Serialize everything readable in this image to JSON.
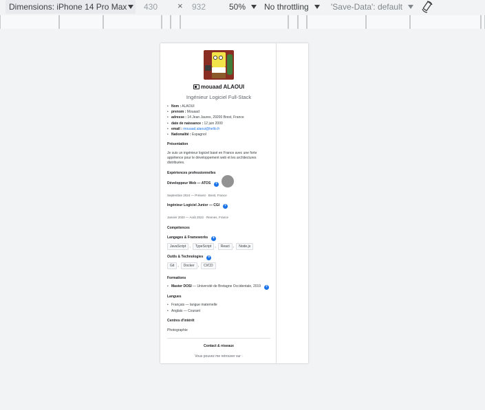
{
  "toolbar": {
    "dimensions_label": "Dimensions: iPhone 14 Pro Max",
    "width_value": "430",
    "times_sign": "×",
    "height_value": "932",
    "zoom": "50%",
    "throttling": "No throttling",
    "save_data": "'Save-Data': default"
  },
  "profile": {
    "name": "mouaad ALAOUI",
    "title": "Ingénieur Logiciel Full-Stack",
    "info": [
      {
        "label": "Nom :",
        "value": "ALAOUI"
      },
      {
        "label": "prenom :",
        "value": "Mouaad"
      },
      {
        "label": "adresse :",
        "value": "14 Jean Jaures, 29200 Brest, France"
      },
      {
        "label": "date de naissance :",
        "value": "12 juin 2000"
      },
      {
        "label": "email :",
        "value": "mouaad.alaoui@hello.fr"
      },
      {
        "label": "Nationalité :",
        "value": "Espagnol"
      }
    ]
  },
  "presentation": {
    "heading": "Présentation",
    "text": "Je suis un ingénieur logiciel basé en France avec une forte appétence pour le développement web et les architectures distribuées."
  },
  "experiences": {
    "heading": "Expériences professionnelles",
    "jobs": [
      {
        "title": "Développeur Web — ATOS",
        "meta": "Septembre 2024 — Présent · Brest, France"
      },
      {
        "title": "Ingénieur Logiciel Junior — CGI",
        "meta": "Janvier 2020 — Août 2022 · Rennes, France"
      }
    ]
  },
  "competences": {
    "heading": "Compétences",
    "groups": [
      {
        "title": "Langages & Frameworks",
        "tags": [
          "JavaScript",
          "TypeScript",
          "React",
          "Node.js"
        ]
      },
      {
        "title": "Outils & Technologies",
        "tags": [
          "Git",
          "Docker",
          "CI/CD"
        ]
      }
    ]
  },
  "formations": {
    "heading": "Formations",
    "degree": "Master DOSI",
    "school": " — Université de Bretagne Occidentale, 2019"
  },
  "langues": {
    "heading": "Langues",
    "items": [
      "Français — langue maternelle",
      "Anglais — Courant"
    ]
  },
  "interets": {
    "heading": "Centres d'intérêt",
    "text": "Photographie"
  },
  "contact": {
    "heading": "Contact & réseaux",
    "text": "Vous pouvez me retrouver sur :"
  },
  "colors": {
    "accent": "#1a73e8",
    "page_bg": "#f1f3f4"
  },
  "icons": [
    "chevron-down-icon",
    "rotate-icon",
    "id-card-icon",
    "plus-icon",
    "touch-cursor"
  ]
}
